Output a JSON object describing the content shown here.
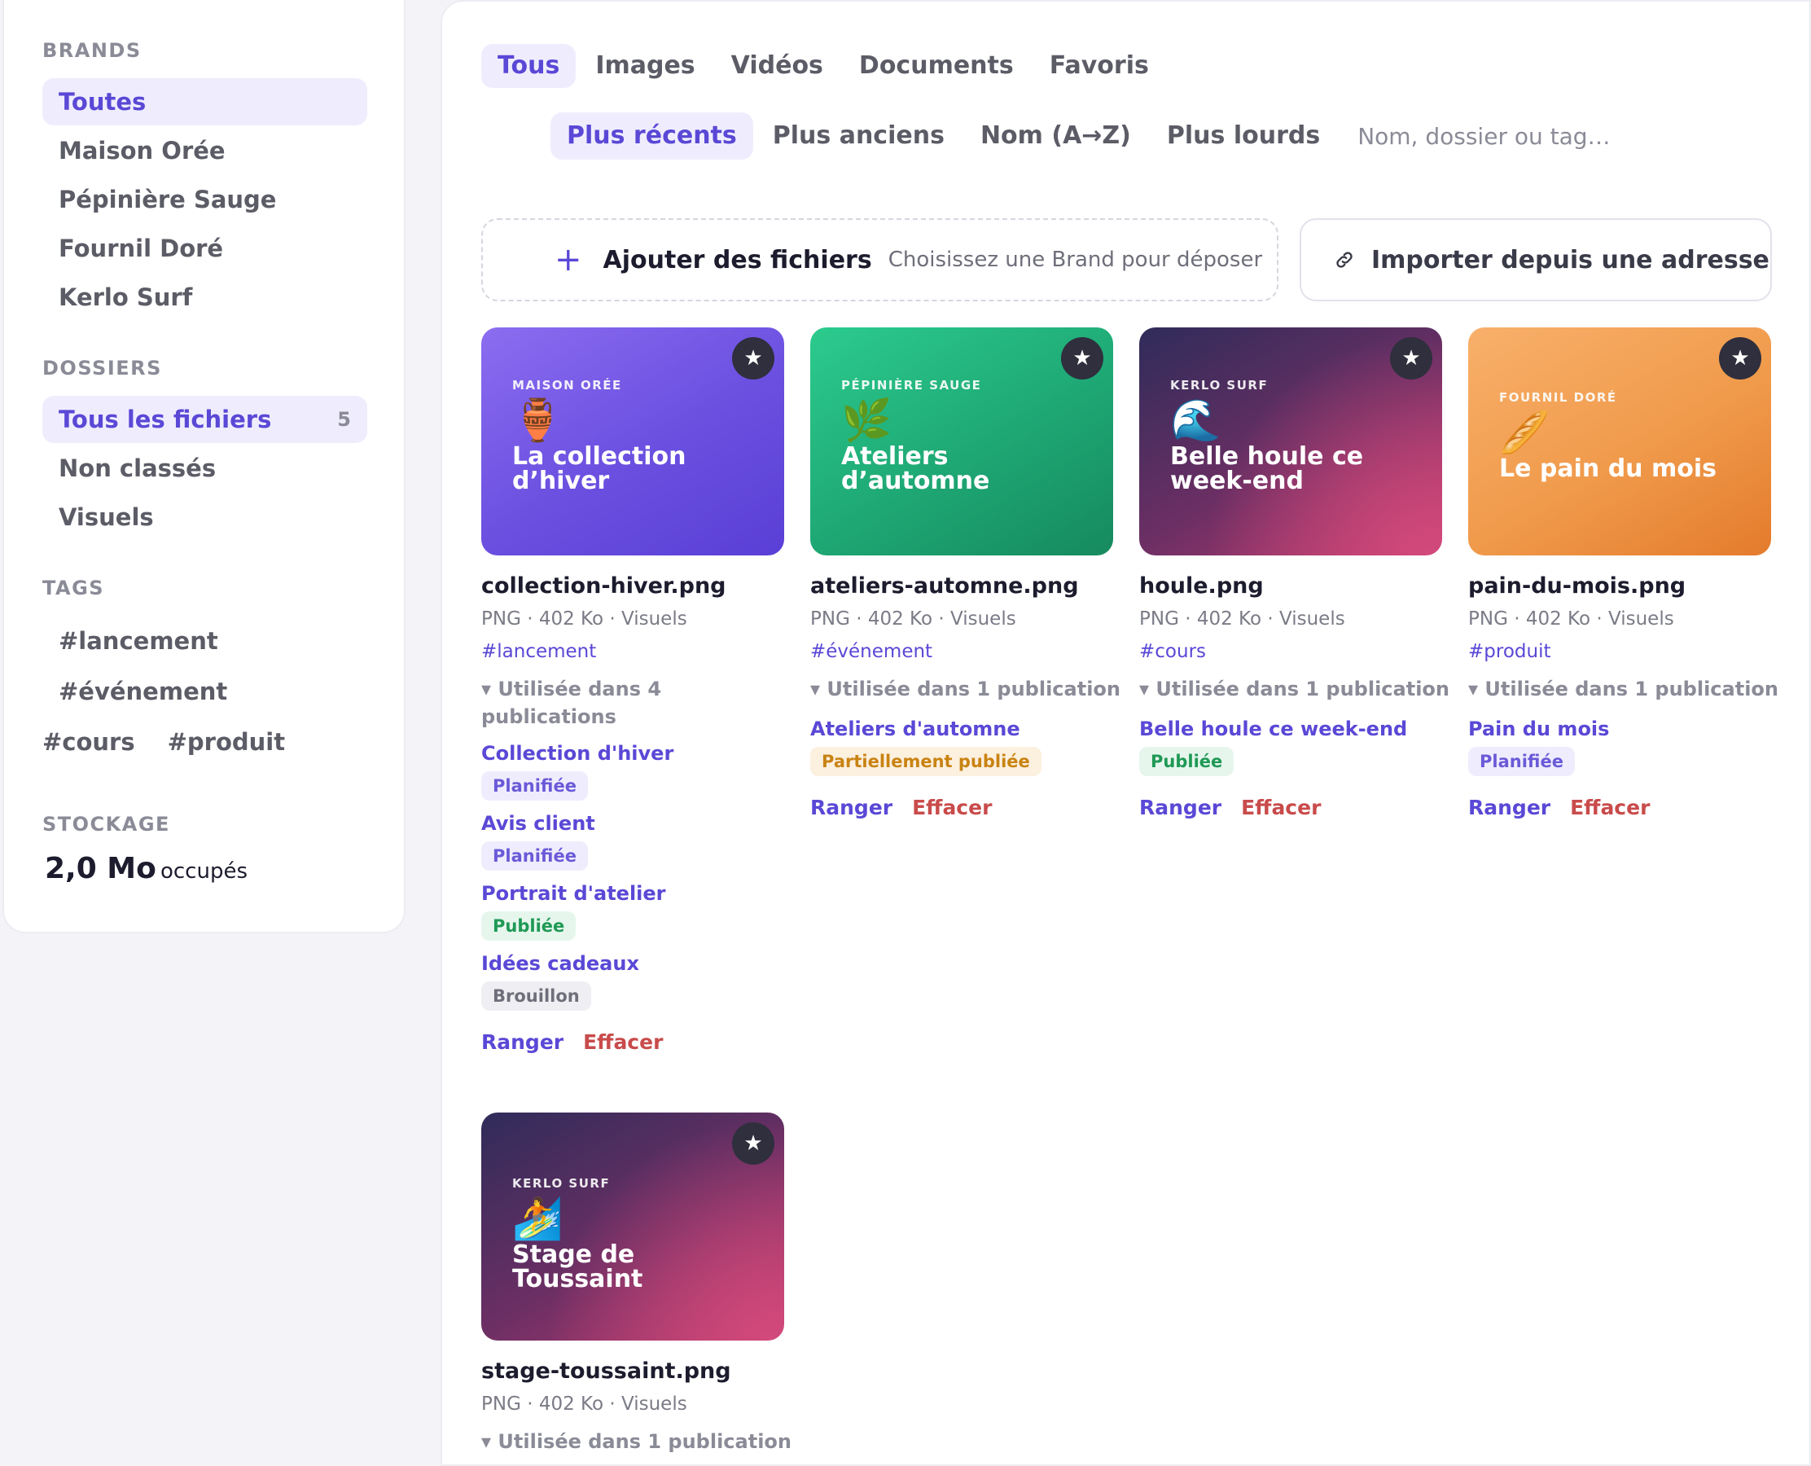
{
  "sidebar": {
    "brands_heading": "BRANDS",
    "brands": [
      {
        "label": "Toutes",
        "active": true
      },
      {
        "label": "Maison Orée"
      },
      {
        "label": "Pépinière Sauge"
      },
      {
        "label": "Fournil Doré"
      },
      {
        "label": "Kerlo Surf"
      }
    ],
    "folders_heading": "DOSSIERS",
    "folders": [
      {
        "label": "Tous les fichiers",
        "count": "5",
        "active": true
      },
      {
        "label": "Non classés"
      },
      {
        "label": "Visuels"
      }
    ],
    "tags_heading": "TAGS",
    "tags": [
      "#lancement",
      "#événement",
      "#cours",
      "#produit"
    ],
    "storage_heading": "STOCKAGE",
    "storage_value": "2,0 Mo",
    "storage_unit": "occupés"
  },
  "tabs": [
    "Tous",
    "Images",
    "Vidéos",
    "Documents",
    "Favoris"
  ],
  "sorts": [
    "Plus récents",
    "Plus anciens",
    "Nom (A→Z)",
    "Plus lourds"
  ],
  "search": {
    "placeholder": "Nom, dossier ou tag…"
  },
  "upload": {
    "plus": "+",
    "title": "Ajouter des fichiers",
    "hint": "Choisissez une Brand pour déposer"
  },
  "import": {
    "label": "Importer depuis une adresse",
    "icon": "link-icon"
  },
  "accent_color": "#5a48d6",
  "danger_color": "#c94b4b",
  "files": [
    {
      "brand": "MAISON ORÉE",
      "emoji": "🏺",
      "title": "La collection d’hiver",
      "name": "collection-hiver.png",
      "meta": "PNG · 402 Ko · Visuels",
      "tag": "#lancement",
      "usage": "▾ Utilisée dans 4 publications",
      "publications": [
        {
          "title": "Collection d'hiver",
          "status": "Planifiée"
        },
        {
          "title": "Avis client",
          "status": "Planifiée"
        },
        {
          "title": "Portrait d'atelier",
          "status": "Publiée"
        },
        {
          "title": "Idées cadeaux",
          "status": "Brouillon"
        }
      ],
      "star": "★",
      "action_move": "Ranger",
      "action_delete": "Effacer"
    },
    {
      "brand": "PÉPINIÈRE SAUGE",
      "emoji": "🌿",
      "title": "Ateliers d’automne",
      "name": "ateliers-automne.png",
      "meta": "PNG · 402 Ko · Visuels",
      "tag": "#événement",
      "usage": "▾ Utilisée dans 1 publication",
      "publications": [
        {
          "title": "Ateliers d'automne",
          "status": "Partiellement publiée"
        }
      ],
      "star": "★",
      "action_move": "Ranger",
      "action_delete": "Effacer"
    },
    {
      "brand": "KERLO SURF",
      "emoji": "🌊",
      "title": "Belle houle ce week-end",
      "name": "houle.png",
      "meta": "PNG · 402 Ko · Visuels",
      "tag": "#cours",
      "usage": "▾ Utilisée dans 1 publication",
      "publications": [
        {
          "title": "Belle houle ce week-end",
          "status": "Publiée"
        }
      ],
      "star": "★",
      "action_move": "Ranger",
      "action_delete": "Effacer"
    },
    {
      "brand": "FOURNIL DORÉ",
      "emoji": "🥖",
      "title": "Le pain du mois",
      "name": "pain-du-mois.png",
      "meta": "PNG · 402 Ko · Visuels",
      "tag": "#produit",
      "usage": "▾ Utilisée dans 1 publication",
      "publications": [
        {
          "title": "Pain du mois",
          "status": "Planifiée"
        }
      ],
      "star": "★",
      "action_move": "Ranger",
      "action_delete": "Effacer"
    },
    {
      "brand": "KERLO SURF",
      "emoji": "🏄",
      "title": "Stage de Toussaint",
      "name": "stage-toussaint.png",
      "meta": "PNG · 402 Ko · Visuels",
      "usage": "▾ Utilisée dans 1 publication",
      "star": "★"
    }
  ]
}
